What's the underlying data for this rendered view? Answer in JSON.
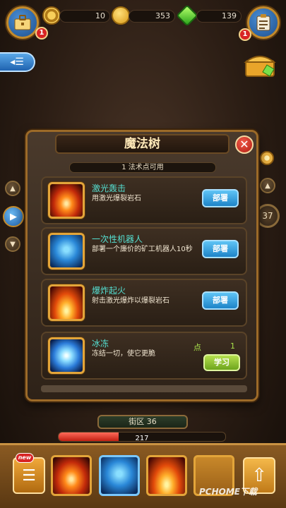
{
  "header": {
    "resources": {
      "gears": "10",
      "coins": "353",
      "gems": "139"
    },
    "left_badge": "1",
    "right_badge": "1"
  },
  "side": {
    "counter": "37"
  },
  "panel": {
    "title": "魔法树",
    "close_label": "✕",
    "points_text": "1 法术点可用",
    "skills": [
      {
        "name": "激光轰击",
        "desc": "用激光爆裂岩石",
        "button": "部署"
      },
      {
        "name": "一次性机器人",
        "desc": "部署一个廉价的矿工机器人10秒",
        "button": "部署"
      },
      {
        "name": "爆炸起火",
        "desc": "射击激光爆炸以爆裂岩石",
        "button": "部署"
      },
      {
        "name": "冰冻",
        "desc": "冻结一切，使它更脆",
        "button": "学习",
        "cost_label": "点",
        "cost": "1"
      }
    ]
  },
  "bottom": {
    "street": "街区 36",
    "progress_value": "217",
    "progress_fraction": 0.36,
    "new_label": "new",
    "watermark": "PCHOME下载"
  }
}
